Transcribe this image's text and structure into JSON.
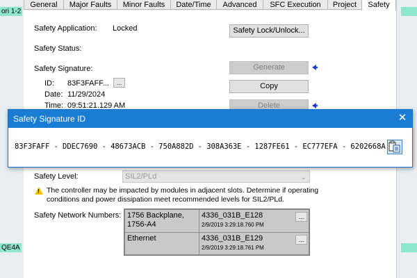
{
  "background": {
    "left_tag_top": "ori 1-2",
    "left_tag_bottom": "QE4A"
  },
  "tabs": [
    {
      "label": "General"
    },
    {
      "label": "Major Faults"
    },
    {
      "label": "Minor Faults"
    },
    {
      "label": "Date/Time"
    },
    {
      "label": "Advanced"
    },
    {
      "label": "SFC Execution"
    },
    {
      "label": "Project"
    },
    {
      "label": "Safety"
    }
  ],
  "active_tab": "Safety",
  "safety": {
    "application_label": "Safety Application:",
    "application_value": "Locked",
    "lock_button": "Safety Lock/Unlock...",
    "status_label": "Safety Status:",
    "signature_label": "Safety Signature:",
    "id_label": "ID:",
    "id_value": "83F3FAFF...",
    "browse": "...",
    "date_label": "Date:",
    "date_value": "11/29/2024",
    "time_label": "Time:",
    "time_value": "09:51:21.129 AM",
    "generate_button": "Generate",
    "copy_button": "Copy",
    "delete_button": "Delete",
    "level_label": "Safety Level:",
    "level_value": "SIL2/PLd",
    "warning_line1": "The controller may be impacted by modules in adjacent slots. Determine if operating",
    "warning_line2": "conditions and power dissipation meet recommended levels for SIL2/PLd.",
    "network_label": "Safety Network Numbers:",
    "networks": [
      {
        "name_line1": "1756 Backplane,",
        "name_line2": "1756-A4",
        "number": "4336_031B_E128",
        "timestamp": "2/9/2019 3:29:18.760 PM",
        "browse": "..."
      },
      {
        "name_line1": "Ethernet",
        "name_line2": "",
        "number": "4336_031B_E129",
        "timestamp": "2/9/2019 3:29:18.761 PM",
        "browse": "..."
      }
    ]
  },
  "signature_dialog": {
    "title": "Safety Signature ID",
    "close": "✕",
    "signature": "83F3FAFF - DDEC7690 - 48673ACB - 750A882D - 308A363E - 1287FE61 - EC777EFA - 6202668A"
  },
  "colors": {
    "titlebar": "#1a7dd4",
    "arrow": "#1a3fd6",
    "warning": "#f2c300"
  }
}
